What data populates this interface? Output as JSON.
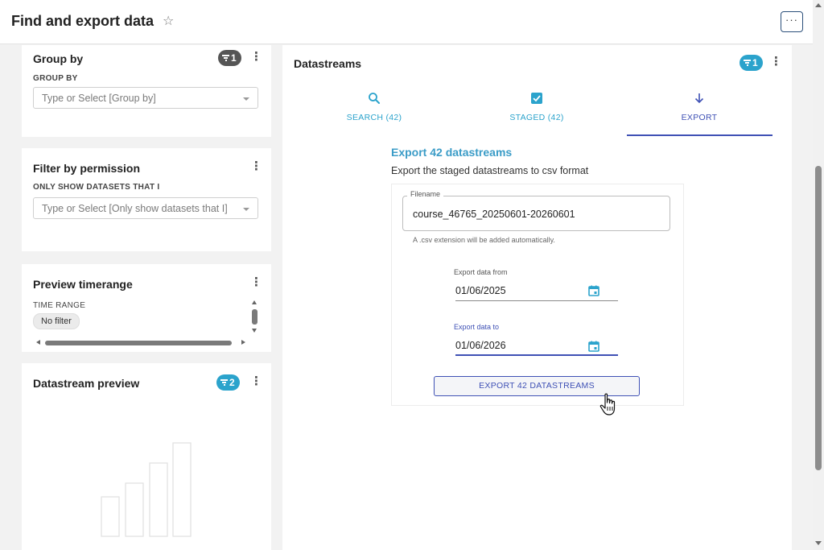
{
  "header": {
    "title": "Find and export data",
    "more_label": "···"
  },
  "group_by": {
    "title": "Group by",
    "badge_count": "1",
    "section_label": "GROUP BY",
    "placeholder": "Type or Select [Group by]"
  },
  "filter_permission": {
    "title": "Filter by permission",
    "section_label": "ONLY SHOW DATASETS THAT I",
    "placeholder": "Type or Select [Only show datasets that I]"
  },
  "preview_timerange": {
    "title": "Preview timerange",
    "section_label": "TIME RANGE",
    "chip": "No filter"
  },
  "datastream_preview": {
    "title": "Datastream preview",
    "badge_count": "2"
  },
  "datastreams": {
    "title": "Datastreams",
    "badge_count": "1",
    "tabs": [
      {
        "label": "SEARCH (42)",
        "icon": "search-icon"
      },
      {
        "label": "STAGED (42)",
        "icon": "checkbox-checked-icon"
      },
      {
        "label": "EXPORT",
        "icon": "arrow-down-icon"
      }
    ],
    "active_tab": 2
  },
  "export": {
    "title": "Export 42 datastreams",
    "description": "Export the staged datastreams to csv format",
    "filename_label": "Filename",
    "filename_value": "course_46765_20250601-20260601",
    "filename_hint": "A .csv extension will be added automatically.",
    "from_label": "Export data from",
    "from_value": "01/06/2025",
    "to_label": "Export data to",
    "to_value": "01/06/2026",
    "button_label": "EXPORT 42 DATASTREAMS"
  },
  "colors": {
    "accent_teal": "#2ba3cc",
    "primary_indigo": "#3f51b5",
    "badge_dark": "#555555"
  }
}
